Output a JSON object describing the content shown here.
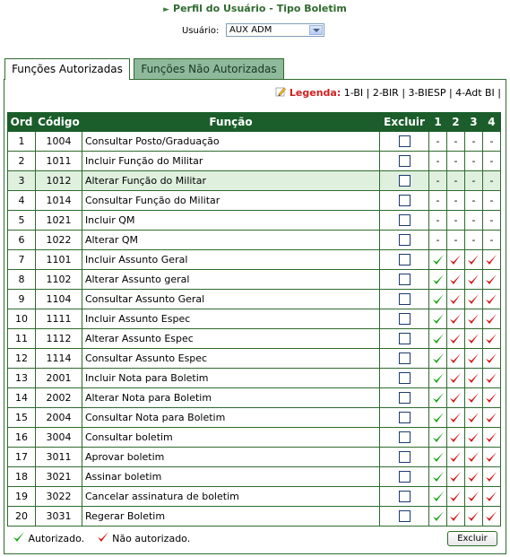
{
  "page": {
    "title": "Perfil do Usuário - Tipo Boletim",
    "user_label": "Usuário:",
    "user_value": "AUX ADM"
  },
  "tabs": [
    {
      "label": "Funções Autorizadas",
      "active": true
    },
    {
      "label": "Funções Não Autorizadas",
      "active": false
    }
  ],
  "legend": {
    "title": "Legenda:",
    "text": "1-BI | 2-BIR | 3-BIESP | 4-Adt BI |"
  },
  "table": {
    "headers": [
      "Ord",
      "Código",
      "Função",
      "Excluir",
      "1",
      "2",
      "3",
      "4"
    ],
    "rows": [
      {
        "ord": "1",
        "code": "1004",
        "func": "Consultar Posto/Graduação",
        "perm": [
          "-",
          "-",
          "-",
          "-"
        ]
      },
      {
        "ord": "2",
        "code": "1011",
        "func": "Incluir Função do Militar",
        "perm": [
          "-",
          "-",
          "-",
          "-"
        ]
      },
      {
        "ord": "3",
        "code": "1012",
        "func": "Alterar Função do Militar",
        "perm": [
          "-",
          "-",
          "-",
          "-"
        ],
        "highlight": true
      },
      {
        "ord": "4",
        "code": "1014",
        "func": "Consultar Função do Militar",
        "perm": [
          "-",
          "-",
          "-",
          "-"
        ]
      },
      {
        "ord": "5",
        "code": "1021",
        "func": "Incluir QM",
        "perm": [
          "-",
          "-",
          "-",
          "-"
        ]
      },
      {
        "ord": "6",
        "code": "1022",
        "func": "Alterar QM",
        "perm": [
          "-",
          "-",
          "-",
          "-"
        ]
      },
      {
        "ord": "7",
        "code": "1101",
        "func": "Incluir Assunto Geral",
        "perm": [
          "g",
          "r",
          "r",
          "r"
        ]
      },
      {
        "ord": "8",
        "code": "1102",
        "func": "Alterar Assunto geral",
        "perm": [
          "g",
          "r",
          "r",
          "r"
        ]
      },
      {
        "ord": "9",
        "code": "1104",
        "func": "Consultar Assunto Geral",
        "perm": [
          "g",
          "r",
          "r",
          "r"
        ]
      },
      {
        "ord": "10",
        "code": "1111",
        "func": "Incluir Assunto Espec",
        "perm": [
          "g",
          "r",
          "r",
          "r"
        ]
      },
      {
        "ord": "11",
        "code": "1112",
        "func": "Alterar Assunto Espec",
        "perm": [
          "g",
          "r",
          "r",
          "r"
        ]
      },
      {
        "ord": "12",
        "code": "1114",
        "func": "Consultar Assunto Espec",
        "perm": [
          "g",
          "r",
          "r",
          "r"
        ]
      },
      {
        "ord": "13",
        "code": "2001",
        "func": "Incluir Nota para Boletim",
        "perm": [
          "g",
          "r",
          "r",
          "r"
        ]
      },
      {
        "ord": "14",
        "code": "2002",
        "func": "Alterar Nota para Boletim",
        "perm": [
          "g",
          "r",
          "r",
          "r"
        ]
      },
      {
        "ord": "15",
        "code": "2004",
        "func": "Consultar Nota para Boletim",
        "perm": [
          "g",
          "r",
          "r",
          "r"
        ]
      },
      {
        "ord": "16",
        "code": "3004",
        "func": "Consultar boletim",
        "perm": [
          "g",
          "r",
          "r",
          "r"
        ]
      },
      {
        "ord": "17",
        "code": "3011",
        "func": "Aprovar boletim",
        "perm": [
          "g",
          "r",
          "r",
          "r"
        ]
      },
      {
        "ord": "18",
        "code": "3021",
        "func": "Assinar boletim",
        "perm": [
          "g",
          "r",
          "r",
          "r"
        ]
      },
      {
        "ord": "19",
        "code": "3022",
        "func": "Cancelar assinatura de boletim",
        "perm": [
          "g",
          "r",
          "r",
          "r"
        ]
      },
      {
        "ord": "20",
        "code": "3031",
        "func": "Regerar Boletim",
        "perm": [
          "g",
          "r",
          "r",
          "r"
        ]
      }
    ]
  },
  "footer": {
    "authorized": "Autorizado.",
    "not_authorized": "Não autorizado.",
    "delete_button": "Excluir"
  },
  "colors": {
    "header_bg": "#1b5e2b",
    "check_green": "#1aa31a",
    "check_red": "#d11a1a",
    "legend_red": "#d21f1f"
  }
}
